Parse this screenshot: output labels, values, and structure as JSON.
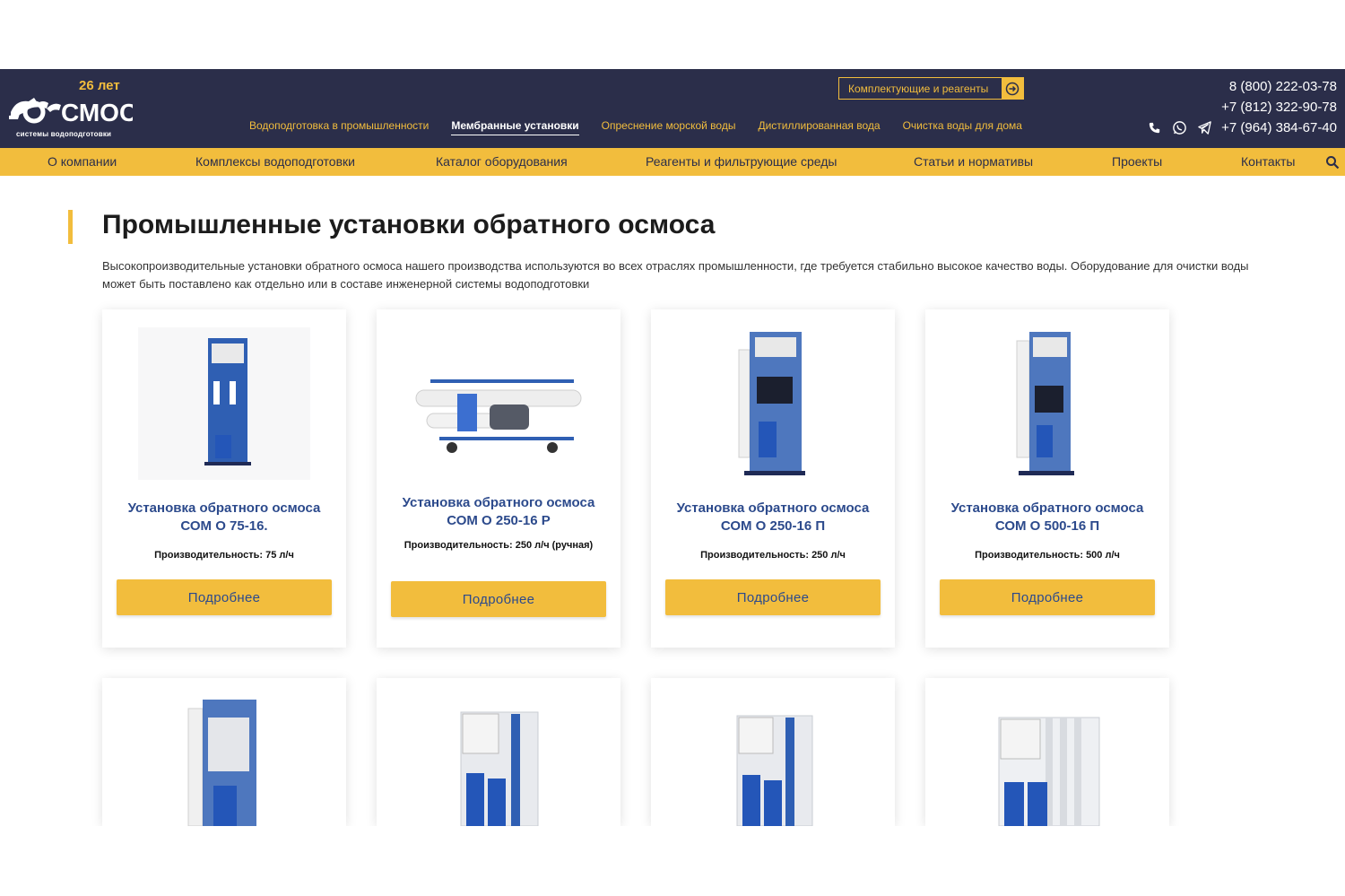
{
  "brand": {
    "years": "26 лет",
    "word": "СМОС",
    "tagline": "системы водоподготовки"
  },
  "header": {
    "components_button": "Комплектующие и реагенты",
    "topnav": [
      {
        "label": "Водоподготовка в промышленности",
        "active": false
      },
      {
        "label": "Мембранные установки",
        "active": true
      },
      {
        "label": "Опреснение морской воды",
        "active": false
      },
      {
        "label": "Дистиллированная вода",
        "active": false
      },
      {
        "label": "Очистка воды для дома",
        "active": false
      }
    ],
    "phones": [
      "8 (800) 222-03-78",
      "+7 (812) 322-90-78",
      "+7 (964) 384-67-40"
    ],
    "contact_icons": [
      "phone-icon",
      "whatsapp-icon",
      "telegram-icon"
    ]
  },
  "mainnav": [
    "О компании",
    "Комплексы водоподготовки",
    "Каталог оборудования",
    "Реагенты и фильтрующие среды",
    "Статьи и нормативы",
    "Проекты",
    "Контакты"
  ],
  "page": {
    "title": "Промышленные установки обратного осмоса",
    "intro": "Высокопроизводительные установки обратного осмоса нашего производства используются во всех отраслях промышленности, где требуется стабильно высокое качество воды. Оборудование для очистки воды может быть поставлено как отдельно или в составе инженерной системы водоподготовки"
  },
  "products": [
    {
      "title": "Установка обратного осмоса СОМ О 75-16.",
      "performance": "Производительность: 75 л/ч",
      "button": "Подробнее"
    },
    {
      "title": "Установка обратного осмоса СОМ О 250-16 Р",
      "performance": "Производительность: 250 л/ч (ручная)",
      "button": "Подробнее"
    },
    {
      "title": "Установка обратного осмоса СОМ О 250-16 П",
      "performance": "Производительность: 250 л/ч",
      "button": "Подробнее"
    },
    {
      "title": "Установка обратного осмоса СОМ О 500-16 П",
      "performance": "Производительность: 500 л/ч",
      "button": "Подробнее"
    }
  ],
  "colors": {
    "header_bg": "#2b2e4a",
    "accent": "#f2bd3d",
    "product_title": "#2c4a8c"
  }
}
